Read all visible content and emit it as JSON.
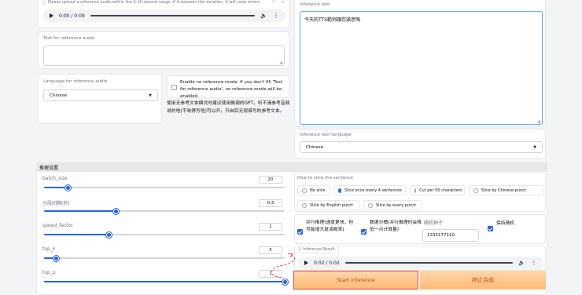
{
  "ref_audio": {
    "hint": "Please upload a reference audio within the 3-10 second range; if it exceeds this duration, it will raise errors.",
    "time": "0:00 / 0:09"
  },
  "ref_text": {
    "label": "Text for reference audio",
    "value": ""
  },
  "ref_language": {
    "label": "Language for reference audio",
    "value": "Chinese"
  },
  "no_ref_mode": {
    "label": "Enable no reference mode. If you don't fill 'Text for reference audio', no reference mode will be enabled.",
    "checked": false
  },
  "no_ref_note": "使用无参考文本模式时建议使用微调的GPT，听不清参考音频说的啥(不晓得写啥)可以开，开启后无视填写的参考文本。",
  "inference_text": {
    "label": "Inference text",
    "value": "今天的TTS範例讓您滿意嗎"
  },
  "inference_language": {
    "label": "Inference text language",
    "value": "Chinese"
  },
  "section_title": "推理设置",
  "sliders": [
    {
      "name": "batch_size",
      "label": "batch_size",
      "value": "20",
      "fraction": 0.1
    },
    {
      "name": "fragment-interval",
      "label": "分段间隔(秒)",
      "value": "0.3",
      "fraction": 0.3
    },
    {
      "name": "speed-factor",
      "label": "speed_factor",
      "value": "1",
      "fraction": 0.27
    },
    {
      "name": "top-k",
      "label": "top_k",
      "value": "5",
      "fraction": 0.05
    },
    {
      "name": "top-p",
      "label": "top_p",
      "value": "1",
      "fraction": 1.0
    }
  ],
  "slice": {
    "label": "How to slice the sentence",
    "options": [
      "No slice",
      "Slice once every 4 sentences",
      "Cut per 50 characters",
      "Slice by Chinese punct",
      "Slice by English punct",
      "Slice by every punct"
    ],
    "selected": "Slice once every 4 sentences"
  },
  "options": {
    "parallel": {
      "label": "并行推理(速度更快，但可能增大复读概率)",
      "checked": true
    },
    "bucket": {
      "label": "数据分桶(并行推理时会降低一点计算量)",
      "checked": true
    },
    "seed_label": "随机种子",
    "seed_value": "1335177110",
    "keep_random": {
      "label": "保持随机",
      "checked": true
    }
  },
  "result": {
    "label": "Inference Result",
    "time": "0:02 / 0:02"
  },
  "buttons": {
    "start": "Start inference",
    "stop": "终止合成"
  },
  "colors": {
    "accent": "#2563eb",
    "button_orange": "#fdba74",
    "annotation_red": "#ef4444"
  }
}
